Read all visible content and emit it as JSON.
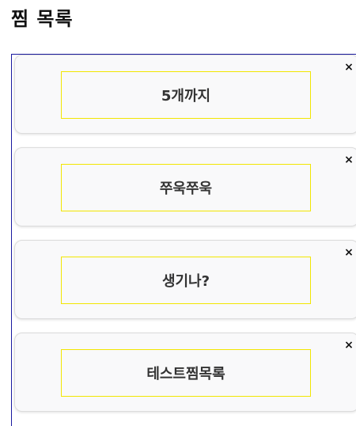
{
  "page": {
    "title": "찜 목록"
  },
  "wishlist": {
    "items": [
      {
        "label": "5개까지",
        "close_glyph": "×"
      },
      {
        "label": "쭈욱쭈욱",
        "close_glyph": "×"
      },
      {
        "label": "생기나?",
        "close_glyph": "×"
      },
      {
        "label": "테스트찜목록",
        "close_glyph": "×"
      }
    ]
  },
  "colors": {
    "container_border": "#1a1aa0",
    "label_box_border": "#f2e600",
    "card_background": "#f9f9fa"
  },
  "icons": {
    "close": "close-icon"
  }
}
